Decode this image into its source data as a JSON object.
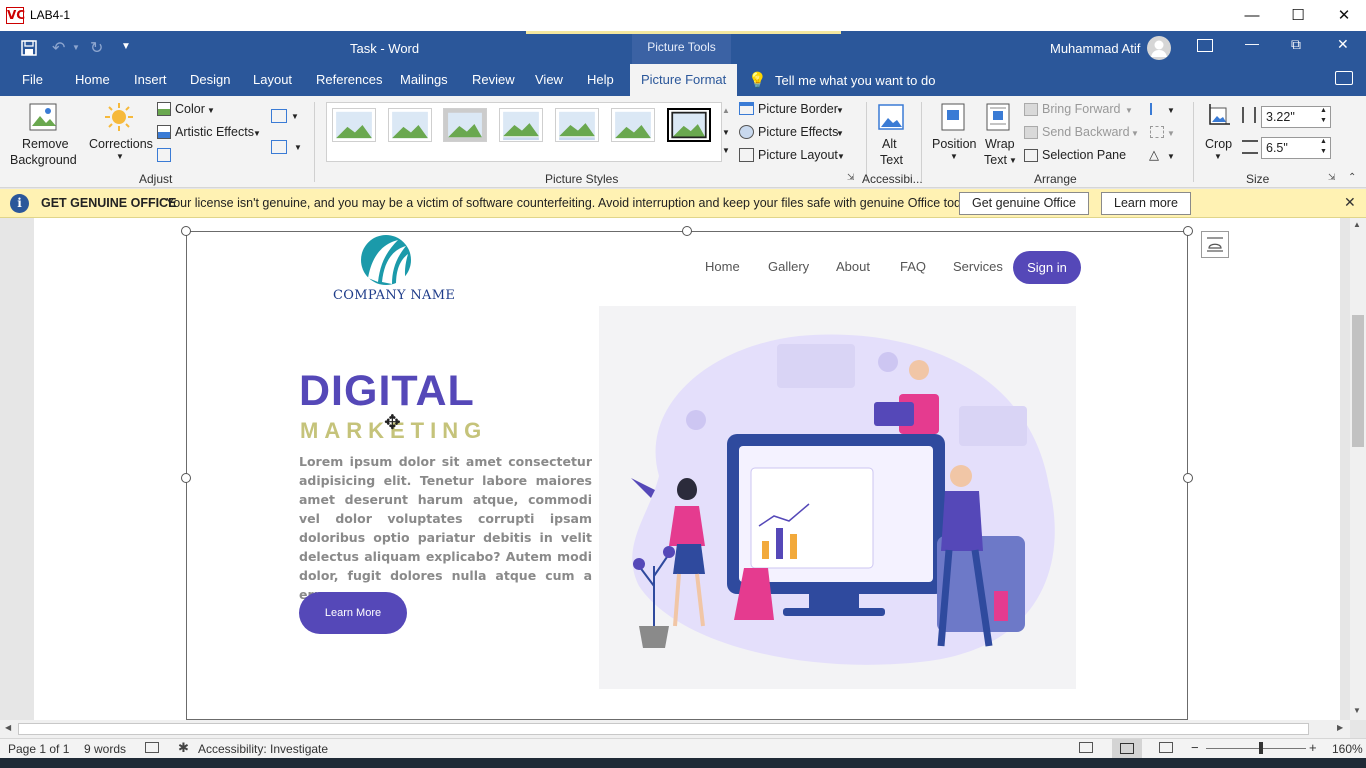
{
  "outer_window": {
    "title": "LAB4-1",
    "app_badge": "VC"
  },
  "title_bar": {
    "doc_title": "Task - Word",
    "contextual_label": "Picture Tools",
    "user_name": "Muhammad Atif"
  },
  "tabs": [
    "File",
    "Home",
    "Insert",
    "Design",
    "Layout",
    "References",
    "Mailings",
    "Review",
    "View",
    "Help",
    "Picture Format"
  ],
  "tell_me": "Tell me what you want to do",
  "ribbon": {
    "adjust": {
      "remove_bg_line1": "Remove",
      "remove_bg_line2": "Background",
      "corrections": "Corrections",
      "color": "Color",
      "artistic": "Artistic Effects",
      "label": "Adjust"
    },
    "styles": {
      "label": "Picture Styles",
      "border": "Picture Border",
      "effects": "Picture Effects",
      "layout": "Picture Layout"
    },
    "access": {
      "alt_line1": "Alt",
      "alt_line2": "Text",
      "label": "Accessibi..."
    },
    "arrange": {
      "position": "Position",
      "wrap_line1": "Wrap",
      "wrap_line2": "Text",
      "bring_forward": "Bring Forward",
      "send_backward": "Send Backward",
      "selection_pane": "Selection Pane",
      "label": "Arrange"
    },
    "size": {
      "crop": "Crop",
      "height": "3.22\"",
      "width": "6.5\"",
      "label": "Size"
    }
  },
  "banner": {
    "title": "GET GENUINE OFFICE",
    "message": "Your license isn't genuine, and you may be a victim of software counterfeiting. Avoid interruption and keep your files safe with genuine Office today.",
    "btn_get": "Get genuine Office",
    "btn_learn": "Learn more"
  },
  "image": {
    "company": "COMPANY NAME",
    "nav": [
      "Home",
      "Gallery",
      "About",
      "FAQ",
      "Services"
    ],
    "sign_in": "Sign in",
    "heading1": "DIGITAL",
    "heading2": "MARKETING",
    "body": "Lorem ipsum dolor sit amet consectetur adipisicing elit. Tenetur labore maiores amet deserunt harum atque, commodi vel dolor voluptates corrupti ipsam doloribus optio pariatur debitis in velit delectus aliquam explicabo? Autem modi dolor, fugit dolores nulla atque cum a error.",
    "cta": "Learn More"
  },
  "status": {
    "page": "Page 1 of 1",
    "words": "9 words",
    "accessibility": "Accessibility: Investigate",
    "zoom": "160%"
  },
  "colors": {
    "word_blue": "#2b579a",
    "purple": "#5548b8",
    "olive": "#c5c37a",
    "banner": "#fff2b3"
  }
}
